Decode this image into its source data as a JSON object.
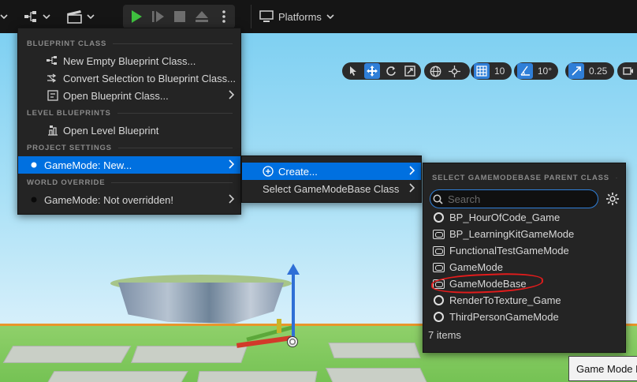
{
  "toolbar": {
    "platforms_label": "Platforms"
  },
  "viewport_toolbar": {
    "grid_snap_value": "10",
    "rotation_snap_value": "10°",
    "scale_snap_value": "0.25"
  },
  "blueprint_menu": {
    "sections": {
      "blueprint_class": "BLUEPRINT CLASS",
      "level_blueprints": "LEVEL BLUEPRINTS",
      "project_settings": "PROJECT SETTINGS",
      "world_override": "WORLD OVERRIDE"
    },
    "items": {
      "new_empty": "New Empty Blueprint Class...",
      "convert_selection": "Convert Selection to Blueprint Class...",
      "open_class": "Open Blueprint Class...",
      "open_level": "Open Level Blueprint",
      "gamemode_new": "GameMode: New...",
      "gamemode_override": "GameMode: Not overridden!"
    }
  },
  "gamemode_submenu": {
    "create": "Create...",
    "select": "Select GameModeBase Class"
  },
  "class_picker": {
    "header": "SELECT GAMEMODEBASE PARENT CLASS",
    "search_placeholder": "Search",
    "classes": [
      {
        "name": "BP_HourOfCode_Game",
        "icon": "circle-icon"
      },
      {
        "name": "BP_LearningKitGameMode",
        "icon": "gamepad-icon"
      },
      {
        "name": "FunctionalTestGameMode",
        "icon": "gamepad-icon"
      },
      {
        "name": "GameMode",
        "icon": "gamepad-icon"
      },
      {
        "name": "GameModeBase",
        "icon": "gamepad-icon"
      },
      {
        "name": "RenderToTexture_Game",
        "icon": "circle-icon"
      },
      {
        "name": "ThirdPersonGameMode",
        "icon": "circle-icon"
      }
    ],
    "count_label": "7 items",
    "annotation_color": "#e21c1c"
  },
  "tooltip": {
    "text": "Game Mode Base"
  },
  "colors": {
    "accent": "#0070e0",
    "menu_bg": "#242424",
    "play_green": "#3fbf3f"
  }
}
